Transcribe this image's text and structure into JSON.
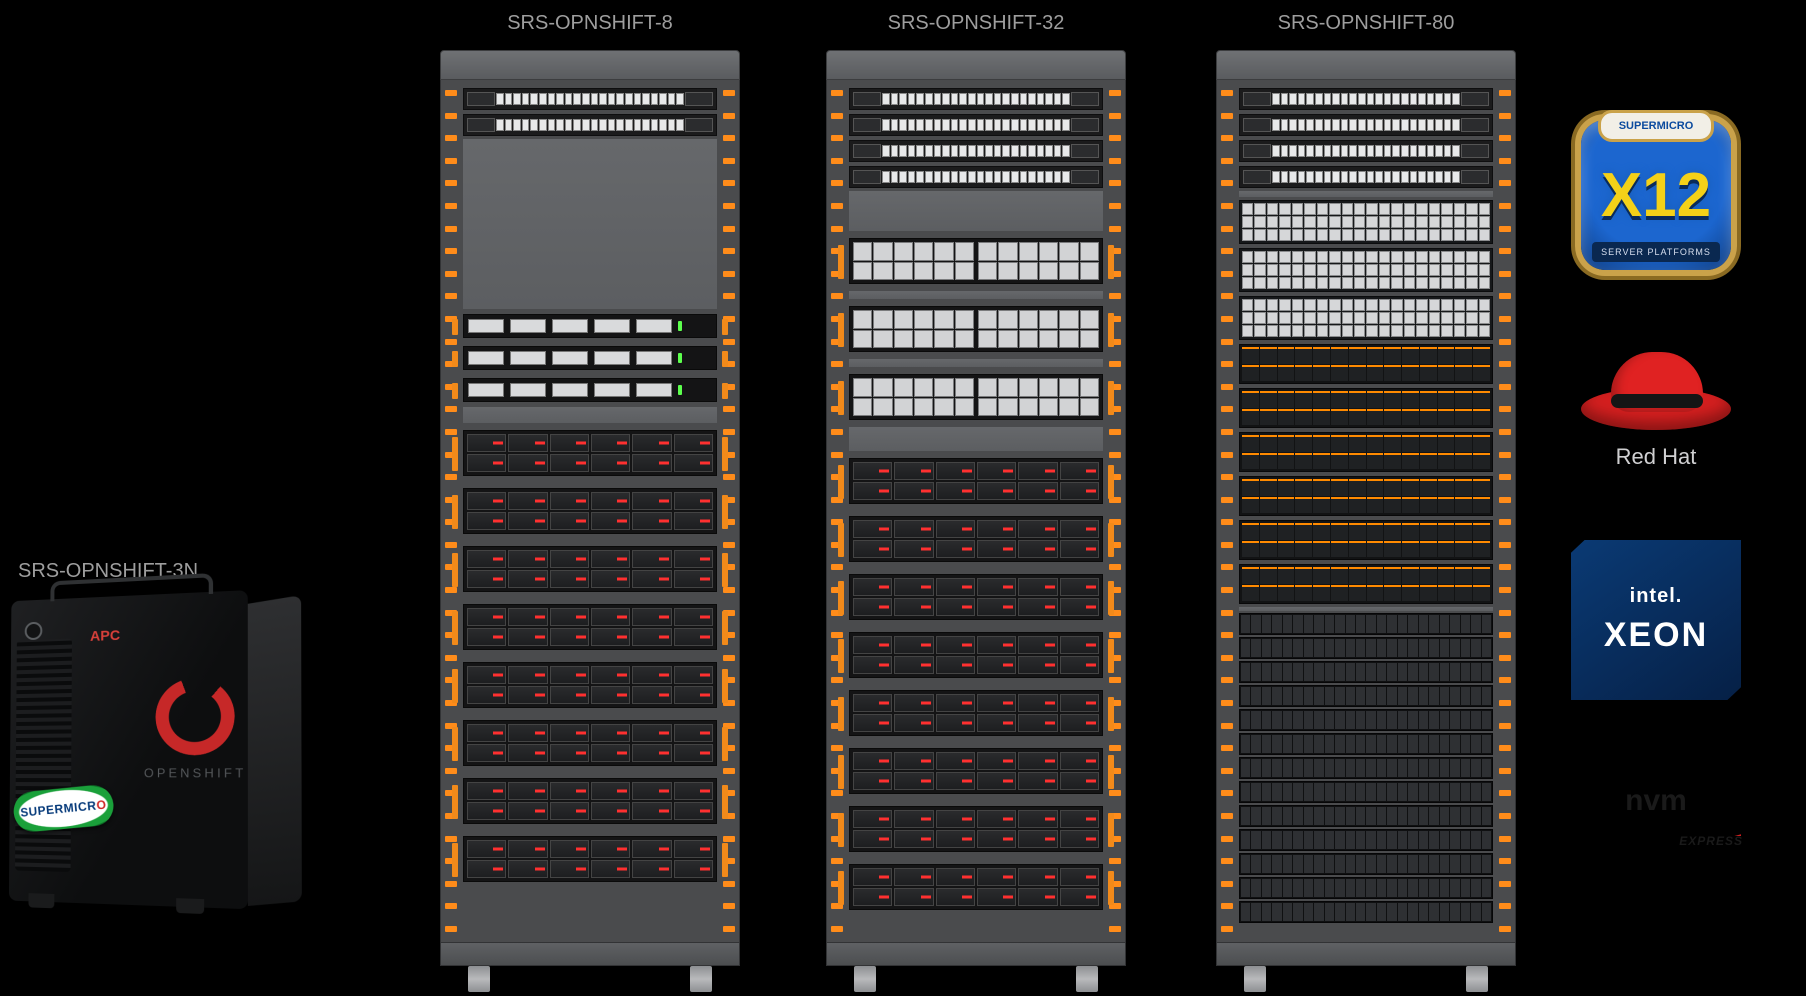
{
  "products": {
    "mini": {
      "label": "SRS-OPNSHIFT-3N"
    },
    "rackA": {
      "label": "SRS-OPNSHIFT-8"
    },
    "rackB": {
      "label": "SRS-OPNSHIFT-32"
    },
    "rackC": {
      "label": "SRS-OPNSHIFT-80"
    }
  },
  "minirack": {
    "apc_label": "APC",
    "openshift_label": "OPENSHIFT",
    "supermicro_badge": "SUPERMICRO"
  },
  "logos": {
    "x12": {
      "pill": "SUPERMICRO",
      "big": "X12",
      "bar": "SERVER PLATFORMS"
    },
    "redhat": {
      "text": "Red Hat"
    },
    "xeon": {
      "brand": "intel.",
      "name": "XEON"
    },
    "nvme": {
      "brand": "nvm",
      "express": "EXPRESS"
    }
  },
  "racks": {
    "A": {
      "layout": [
        "switch",
        "switch",
        "blank:170",
        "ctrl",
        "ctrl",
        "ctrl",
        "blank:16",
        "wrk",
        "wrk",
        "wrk",
        "wrk",
        "wrk",
        "wrk",
        "wrk",
        "wrk"
      ]
    },
    "B": {
      "layout": [
        "switch",
        "switch",
        "switch",
        "switch",
        "blank:40",
        "twin",
        "blank:8",
        "twin",
        "blank:8",
        "twin",
        "blank:24",
        "wrk",
        "wrk",
        "wrk",
        "wrk",
        "wrk",
        "wrk",
        "wrk",
        "wrk"
      ]
    },
    "C": {
      "layout": [
        "switch",
        "switch",
        "switch",
        "switch",
        "blank:6",
        "dense",
        "dense",
        "dense",
        "nvme",
        "nvme",
        "nvme",
        "nvme",
        "nvme",
        "nvme",
        "blank:4",
        "blade",
        "blade",
        "blade",
        "blade",
        "blade",
        "blade",
        "blade",
        "blade",
        "blade",
        "blade",
        "blade",
        "blade",
        "blade"
      ]
    }
  }
}
